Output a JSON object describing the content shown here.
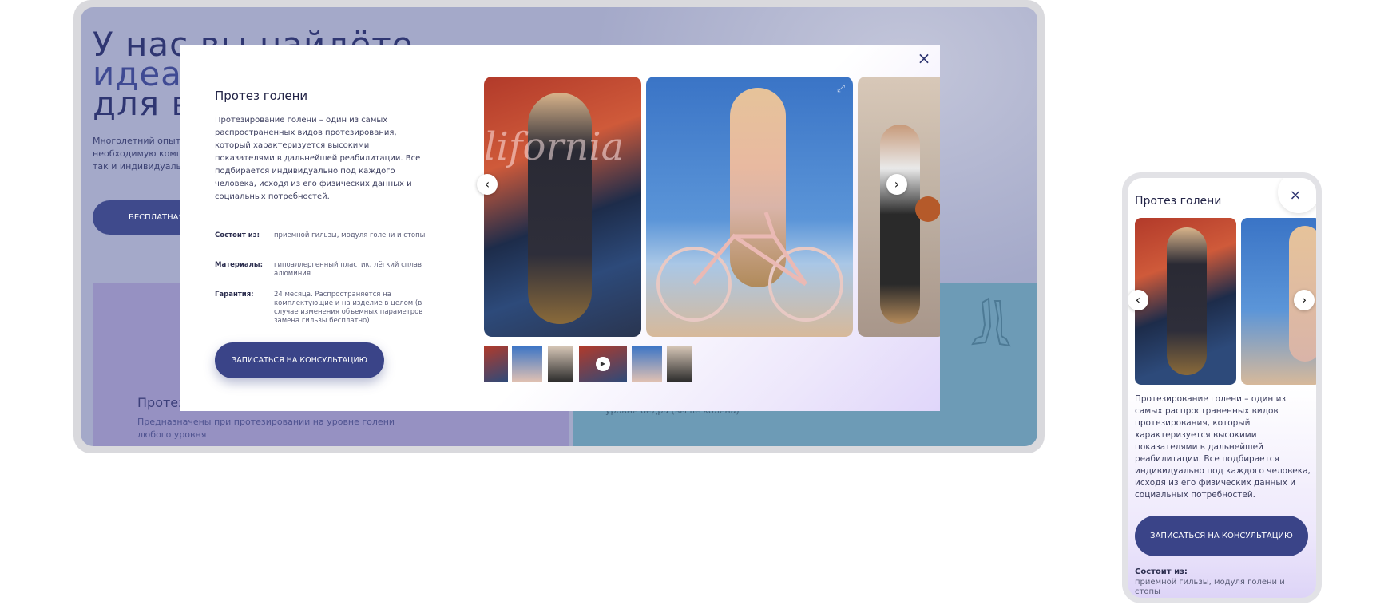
{
  "background_page": {
    "hero_title_line1": "У нас вы найдёте",
    "hero_title_line2": "идеал",
    "hero_title_line3": "для вс",
    "hero_text": "Многолетний опыт необходимую компл так и индивидуальн",
    "hero_button": "БЕСПЛАТНАЯ",
    "card_left_title": "Протез г",
    "card_left_text": "Предназначены при протезировании на уровне голени любого уровня",
    "card_right_text": "Предназначены при ампутации на уровне бедра (выше колена)",
    "card_left_color": "#9691c2",
    "card_right_color": "#6d9bb6"
  },
  "modal": {
    "close_icon": "×",
    "title": "Протез голени",
    "description": "Протезирование голени – один из самых распространенных видов протезирования, который характеризуется высокими показателями в дальнейшей реабилитации. Все подбирается индивидуально под каждого человека, исходя из его физических данных и социальных потребностей.",
    "specs": [
      {
        "label": "Состоит из:",
        "value": "приемной гильзы, модуля голени и стопы"
      },
      {
        "label": "Материалы:",
        "value": "гипоаллергенный пластик, лёгкий сплав алюминия"
      },
      {
        "label": "Гарантия:",
        "value": "24 месяца. Распространяется на комплектующие и на изделие в целом (в случае изменения объемных параметров замена гильзы бесплатно)"
      }
    ],
    "button": "ЗАПИСАТЬСЯ НА КОНСУЛЬТАЦИЮ",
    "arrow_prev": "‹",
    "arrow_next": "›",
    "play_icon": "▶",
    "expand_icon": "⤢",
    "accent_color": "#3a4488"
  },
  "mobile": {
    "title": "Протез голени",
    "close_icon": "×",
    "description": "Протезирование голени – один из самых распространенных видов протезирования, который характеризуется высокими показателями в дальнейшей реабилитации. Все подбирается индивидуально под каждого человека, исходя из его физических данных и социальных потребностей.",
    "button": "ЗАПИСАТЬСЯ НА КОНСУЛЬТАЦИЮ",
    "spec_label": "Состоит из:",
    "spec_value": "приемной гильзы, модуля голени и стопы",
    "arrow_prev": "‹",
    "arrow_next": "›"
  }
}
